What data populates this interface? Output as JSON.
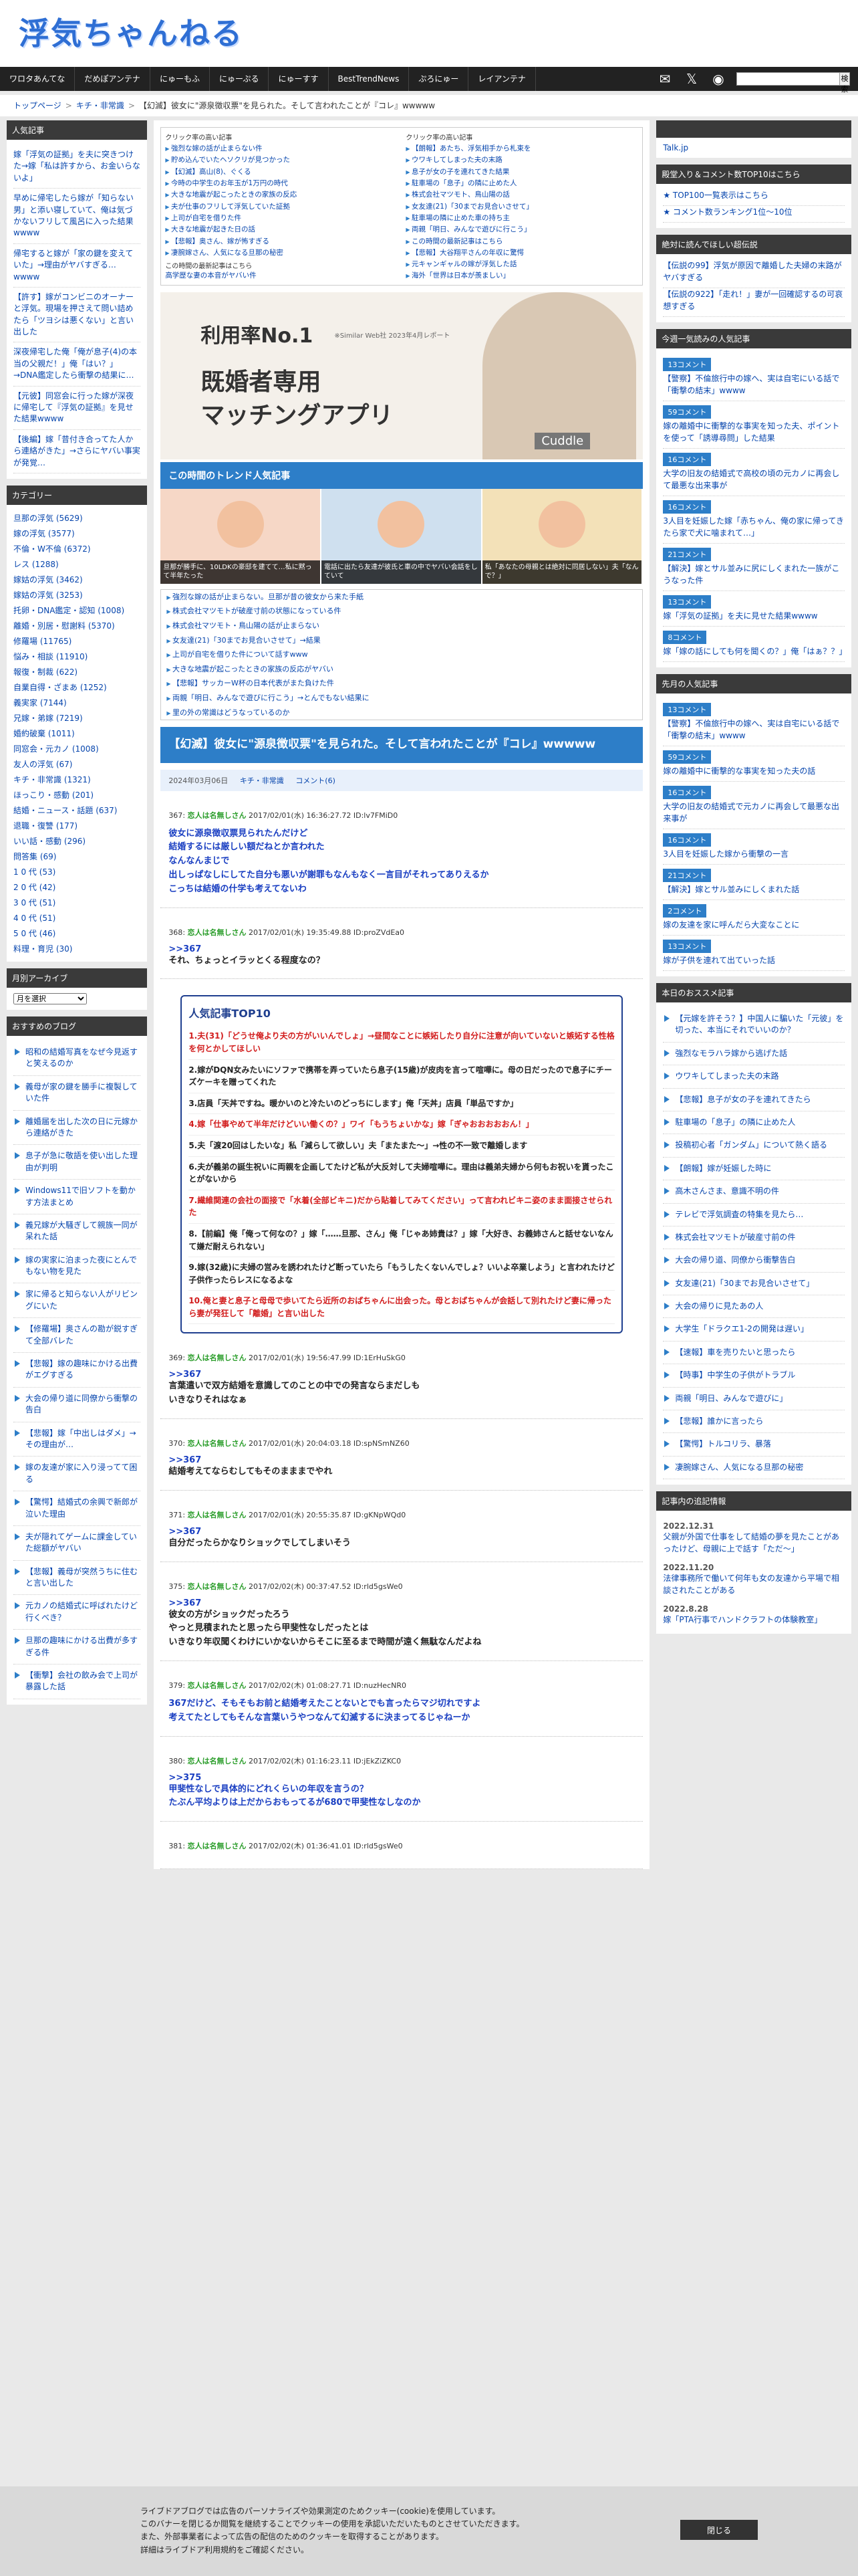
{
  "site": {
    "title": "浮気ちゃんねる"
  },
  "nav": [
    "ワロタあんてな",
    "だめぽアンテナ",
    "にゅーもふ",
    "にゅーぷる",
    "にゅーすす",
    "BestTrendNews",
    "ぷろにゅー",
    "レイアンテナ"
  ],
  "search": {
    "button": "検索"
  },
  "breadcrumb": [
    "トップページ",
    "キチ・非常識",
    "【幻滅】彼女に\"源泉徴収票\"を見られた。そして言われたことが『コレ』wwwww"
  ],
  "left": {
    "news_title": "人気記事",
    "news": [
      "嫁「浮気の証拠」を夫に突きつけた→嫁「私は許すから、お金いらないよ」",
      "早めに帰宅したら嫁が「知らない男」と添い寝していて、俺は気づかないフリして風呂に入った結果wwww",
      "帰宅すると嫁が「家の鍵を変えていた」→理由がヤバすぎる…wwww",
      "【許す】嫁がコンビニのオーナーと浮気。現場を押さえて問い詰めたら「ツヨシは悪くない」と言い出した",
      "深夜帰宅した俺「俺が息子(4)の本当の父親だ！」俺「はい？」→DNA鑑定したら衝撃の結果に…",
      "【元彼】同窓会に行った嫁が深夜に帰宅して『浮気の証拠』を見せた結果wwww",
      "【後編】嫁「昔付き合ってた人から連絡がきた」→さらにヤバい事実が発覚…"
    ],
    "cat_title": "カテゴリー",
    "cats": [
      "旦那の浮気 (5629)",
      "嫁の浮気 (3577)",
      "不倫・W不倫 (6372)",
      "レス (1288)",
      "嫁姑の浮気 (3462)",
      "嫁姑の浮気 (3253)",
      "托卵・DNA鑑定・認知 (1008)",
      "離婚・別居・慰謝料 (5370)",
      "修羅場 (11765)",
      "悩み・相談 (11910)",
      "報復・制裁 (622)",
      "自業自得・ざまあ (1252)",
      "義実家 (7144)",
      "兄嫁・弟嫁 (7219)",
      "婚約破棄 (1011)",
      "同窓会・元カノ (1008)",
      "友人の浮気 (67)",
      "キチ・非常識 (1321)",
      "ほっこり・感動 (201)",
      "結婚・ニュース・話題 (637)",
      "退職・復讐 (177)",
      "いい話・感動 (296)",
      "問答集 (69)",
      "1 0 代 (53)",
      "2 0 代 (42)",
      "3 0 代 (51)",
      "4 0 代 (51)",
      "5 0 代 (46)",
      "料理・育児 (30)"
    ],
    "month_title": "月別アーカイブ",
    "month_sel": "月を選択",
    "rec_title": "おすすめのブログ",
    "rec": [
      "昭和の結婚写真をなぜ今見返すと笑えるのか",
      "義母が家の鍵を勝手に複製していた件",
      "離婚届を出した次の日に元嫁から連絡がきた",
      "息子が急に敬語を使い出した理由が判明",
      "Windows11で旧ソフトを動かす方法まとめ",
      "義兄嫁が大騒ぎして親族一同が呆れた話",
      "嫁の実家に泊まった夜にとんでもない物を見た",
      "家に帰ると知らない人がリビングにいた",
      "【修羅場】奥さんの勘が鋭すぎて全部バレた",
      "【悲報】嫁の趣味にかける出費がエグすぎる",
      "大会の帰り道に同僚から衝撃の告白",
      "【悲報】嫁「中出しはダメ」→その理由が…",
      "嫁の友達が家に入り浸ってて困る",
      "【驚愕】結婚式の余興で新郎が泣いた理由",
      "夫が隠れてゲームに課金していた総額がヤバい",
      "【悲報】義母が突然うちに住むと言い出した",
      "元カノの結婚式に呼ばれたけど行くべき？",
      "旦那の趣味にかける出費が多すぎる件",
      "【衝撃】会社の飲み会で上司が暴露した話"
    ]
  },
  "main": {
    "rec_l_title": "クリック率の高い記事",
    "rec_l": [
      "強烈な嫁の話が止まらない件",
      "貯め込んでいたヘソクリが見つかった",
      "【幻滅】高山(8)、ぐくる",
      "今時の中学生のお年玉が1万円の時代",
      "大きな地震が起こったときの家族の反応",
      "夫が仕事のフリして浮気していた証拠",
      "上司が自宅を借りた件",
      "大きな地震が起きた日の話",
      "【悲報】奥さん、嫁が怖すぎる",
      "凄腕嫁さん、人気になる旦那の秘密"
    ],
    "rec_l_foot": "この時間の最新記事はこちら",
    "rec_l_foot2": "高学歴な妻の本音がヤバい件",
    "rec_r_title": "クリック率の高い記事",
    "rec_r": [
      "【朗報】あたち、浮気相手から札束を",
      "ウワキしてしまった夫の末路",
      "息子が女の子を連れてきた結果",
      "駐車場の「息子」の隣に止めた人",
      "株式会社マツモト、鳥山陽の話",
      "女友達(21)「30までお見合いさせて」",
      "駐車場の隣に止めた車の持ち主",
      "両親「明日、みんなで遊びに行こう」",
      "この時間の最新記事はこちら",
      "【悲報】大谷翔平さんの年収に驚愕",
      "元キャンギャルの嫁が浮気した話",
      "海外「世界は日本が羨ましい」"
    ],
    "ad": {
      "line1": "利用率No.1",
      "tag": "※Similar Web社 2023年4月レポート",
      "line2": "既婚者専用\nマッチングアプリ",
      "brand": "Cuddle"
    },
    "trend_title": "この時間のトレンド人気記事",
    "trend": [
      "旦那が勝手に、10LDKの豪邸を建てて…私に黙って半年たった",
      "電話に出たら友達が彼氏と車の中でヤバい会話をしていて",
      "私「あなたの母親とは絶対に同居しない」夫「なんで？」"
    ],
    "list2": [
      "強烈な嫁の話が止まらない。旦那が昔の彼女から来た手紙",
      "株式会社マツモトが破産寸前の状態になっている件",
      "株式会社マツモト・鳥山陽の話が止まらない",
      "女友達(21)「30までお見合いさせて」→結果",
      "上司が自宅を借りた件について話すwww",
      "大きな地震が起こったときの家族の反応がヤバい",
      "【悲報】サッカーW杯の日本代表がまた負けた件",
      "両親「明日、みんなで遊びに行こう」→とんでもない結果に",
      "里の外の常識はどうなっているのか"
    ],
    "title": "【幻滅】彼女に\"源泉徴収票\"を見られた。そして言われたことが『コレ』wwwww",
    "meta": {
      "date": "2024年03月06日",
      "cat": "キチ・非常識",
      "comment": "コメント(6)"
    },
    "posts": [
      {
        "id": "367",
        "name": "恋人は名無しさん",
        "date": "2017/02/01(水) 16:36:27.72 ID:lv7FMiD0",
        "body": "彼女に源泉徴収票見られたんだけど\n結婚するには厳しい額だねとか言われた\nなんなんまじで\n出しっぱなしにしてた自分も悪いが謝罪もなんもなく一言目がそれってありえるか\nこっちは結婚の什学も考えてないわ",
        "color": "blue",
        "anchor": ""
      },
      {
        "id": "368",
        "name": "恋人は名無しさん",
        "date": "2017/02/01(水) 19:35:49.88 ID:proZVdEa0",
        "body": "それ、ちょっとイラッとくる程度なの？",
        "color": "black",
        "anchor": ">>367"
      }
    ],
    "top10_title": "人気記事TOP10",
    "top10": [
      "1.夫(31)「どうせ俺より夫の方がいいんでしょ」→昼間なことに嫉妬したり自分に注意が向いていないと嫉妬する性格を何とかしてほしい",
      "2.嫁がDQN女みたいにソファで携帯を弄っていたら息子(15歳)が皮肉を言って喧嘩に。母の日だったので息子にチーズケーキを贈ってくれた",
      "3.店員「天丼ですね。暖かいのと冷たいのどっちにします」俺「天丼」店員「単品ですか」",
      "4.嫁「仕事やめて半年だけどいい働くの？」ワイ「もうちょいかな」嫁「ぎゃおおおおおん！」",
      "5.夫「渡20回はしたいな」私「減らして欲しい」夫「またまた〜」→性の不一致で離婚します",
      "6.夫が義弟の誕生祝いに両親を企画してたけど私が大反対して夫婦喧嘩に。理由は義弟夫婦から何もお祝いを貰ったことがないから",
      "7.繊維関連の会社の面接で「水着(全部ビキニ)だから貼着してみてください」って言われビキニ姿のまま面接させられた",
      "8.【前編】俺「俺って何なの？」嫁「……旦那、さん」俺「じゃあ姉貴は？」嫁「大好き、お義姉さんと話せないなんて嫌だ耐えられない」",
      "9.嫁(32歳)に夫婦の営みを誘われたけど断っていたら「もうしたくないんでしょ？いいよ卒業しよう」と言われたけど子供作ったらレスになるよな",
      "10.俺と妻と息子と母母で歩いてたら近所のおばちゃんに出会った。母とおばちゃんが会話して別れたけど妻に帰ったら妻が発狂して「離婚」と言い出した"
    ],
    "posts2": [
      {
        "id": "369",
        "name": "恋人は名無しさん",
        "date": "2017/02/01(水) 19:56:47.99 ID:1ErHuSkG0",
        "body": "言葉遣いで双方結婚を意識してのことの中での発言ならまだしも\nいきなりそれはなぁ",
        "color": "black",
        "anchor": ">>367"
      },
      {
        "id": "370",
        "name": "恋人は名無しさん",
        "date": "2017/02/01(水) 20:04:03.18 ID:spNSmNZ60",
        "body": "結婚考えてならむしてもそのまままでやれ",
        "color": "black",
        "anchor": ">>367"
      },
      {
        "id": "371",
        "name": "恋人は名無しさん",
        "date": "2017/02/01(水) 20:55:35.87 ID:gKNpWQd0",
        "body": "自分だったらかなりショックでしてしまいそう",
        "color": "black",
        "anchor": ">>367"
      },
      {
        "id": "375",
        "name": "恋人は名無しさん",
        "date": "2017/02/02(木) 00:37:47.52 ID:rld5gsWe0",
        "body": "彼女の方がショックだったろう\nやっと見積まれたと思ったら甲斐性なしだったとは\nいきなり年収聞くわけにいかないからそこに至るまで時間が遠く無駄なんだよね",
        "color": "black",
        "anchor": ">>367"
      },
      {
        "id": "379",
        "name": "恋人は名無しさん",
        "date": "2017/02/02(木) 01:08:27.71 ID:nuzHecNR0",
        "body": "367だけど、そもそもお前と結婚考えたことないとでも言ったらマジ切れですよ\n考えてたとしてもそんな言葉いうやつなんて幻滅するに決まってるじゃねーか",
        "color": "blue",
        "anchor": ""
      },
      {
        "id": "380",
        "name": "恋人は名無しさん",
        "date": "2017/02/02(木) 01:16:23.11 ID:jEkZiZKC0",
        "body": "甲斐性なしで具体的にどれくらいの年収を言うの？\nたぶん平均よりは上だからおもってるが680で甲斐性なしなのか",
        "color": "blue",
        "anchor": ">>375"
      },
      {
        "id": "381",
        "name": "恋人は名無しさん",
        "date": "2017/02/02(木) 01:36:41.01 ID:rld5gsWe0",
        "body": "",
        "color": "black",
        "anchor": ""
      }
    ]
  },
  "right": {
    "talk": "Talk.jp",
    "h1": "殿堂入り＆コメント数TOP10はこちら",
    "links": [
      "★ TOP100一覧表示はこちら",
      "★ コメント数ランキング1位〜10位"
    ],
    "h2": "絶対に読んでほしい超伝説",
    "legend": [
      "【伝説の99】浮気が原因で離婚した夫婦の末路がヤバすぎる",
      "【伝説の922】「走れ！」妻が一回確認するの可哀想すぎる"
    ],
    "h3": "今週一気読みの人気記事",
    "week": [
      {
        "b": "13コメント",
        "t": "【警察】不倫旅行中の嫁へ、実は自宅にいる話で「衝撃の結末」wwww"
      },
      {
        "b": "59コメント",
        "t": "嫁の離婚中に衝撃的な事実を知った夫、ポイントを使って「誘導尋問」した結果"
      },
      {
        "b": "16コメント",
        "t": "大学の旧友の結婚式で高校の頃の元カノに再会して最悪な出来事が"
      },
      {
        "b": "16コメント",
        "t": "3人目を妊娠した嫁「赤ちゃん、俺の家に帰ってきたら家で犬に噛まれて…」"
      },
      {
        "b": "21コメント",
        "t": "【解決】嫁とサル並みに尻にしくまれた一族がこうなった件"
      },
      {
        "b": "13コメント",
        "t": "嫁「浮気の証拠」を夫に見せた結果wwww"
      },
      {
        "b": "8コメント",
        "t": "嫁「嫁の話にしても何を聞くの？」俺「はぁ？？」"
      }
    ],
    "h4": "先月の人気記事",
    "month": [
      {
        "b": "13コメント",
        "t": "【警察】不倫旅行中の嫁へ、実は自宅にいる話で「衝撃の結末」wwww"
      },
      {
        "b": "59コメント",
        "t": "嫁の離婚中に衝撃的な事実を知った夫の話"
      },
      {
        "b": "16コメント",
        "t": "大学の旧友の結婚式で元カノに再会して最悪な出来事が"
      },
      {
        "b": "16コメント",
        "t": "3人目を妊娠した嫁から衝撃の一言"
      },
      {
        "b": "21コメント",
        "t": "【解決】嫁とサル並みにしくまれた話"
      },
      {
        "b": "2コメント",
        "t": "嫁の友達を家に呼んだら大変なことに"
      },
      {
        "b": "13コメント",
        "t": "嫁が子供を連れて出ていった話"
      }
    ],
    "h5": "本日のおススメ記事",
    "today": [
      "【元嫁を許そう？】中国人に騙いた「元彼」を切った、本当にそれでいいのか？",
      "強烈なモラハラ嫁から逃げた話",
      "ウワキしてしまった夫の末路",
      "【悲報】息子が女の子を連れてきたら",
      "駐車場の「息子」の隣に止めた人",
      "投稿初心者「ガンダム」について熱く語る",
      "【朗報】嫁が妊娠した時に",
      "高木さんさま、意識不明の件",
      "テレビで浮気調査の特集を見たら…",
      "株式会社マツモトが破産寸前の件",
      "大会の帰り道、同僚から衝撃告白",
      "女友達(21)「30までお見合いさせて」",
      "大会の帰りに見たあの人",
      "大学生「ドラクエ1-2の開発は遅い」",
      "【速報】車を売りたいと思ったら",
      "【時事】中学生の子供がトラブル",
      "両親「明日、みんなで遊びに」",
      "【悲報】誰かに言ったら",
      "【驚愕】トルコリラ、暴落",
      "凄腕嫁さん、人気になる旦那の秘密"
    ],
    "h6": "記事内の追記情報",
    "notes": [
      {
        "d": "2022.12.31",
        "t": "父親が外国で仕事をして結婚の夢を見たことがあったけど、母親に上で話す「ただ〜」"
      },
      {
        "d": "2022.11.20",
        "t": "法律事務所で働いて何年も女の友達から平場で相談されたことがある"
      },
      {
        "d": "2022.8.28",
        "t": "嫁「PTA行事でハンドクラフトの体験教室」"
      }
    ]
  },
  "cookie": {
    "text": "ライブドアブログでは広告のパーソナライズや効果測定のためクッキー(cookie)を使用しています。\nこのバナーを閉じるか閲覧を継続することでクッキーの使用を承認いただいたものとさせていただきます。\nまた、外部事業者によって広告の配信のためのクッキーを取得することがあります。\n詳細はライブドア利用規約をご確認ください。",
    "close": "閉じる"
  }
}
